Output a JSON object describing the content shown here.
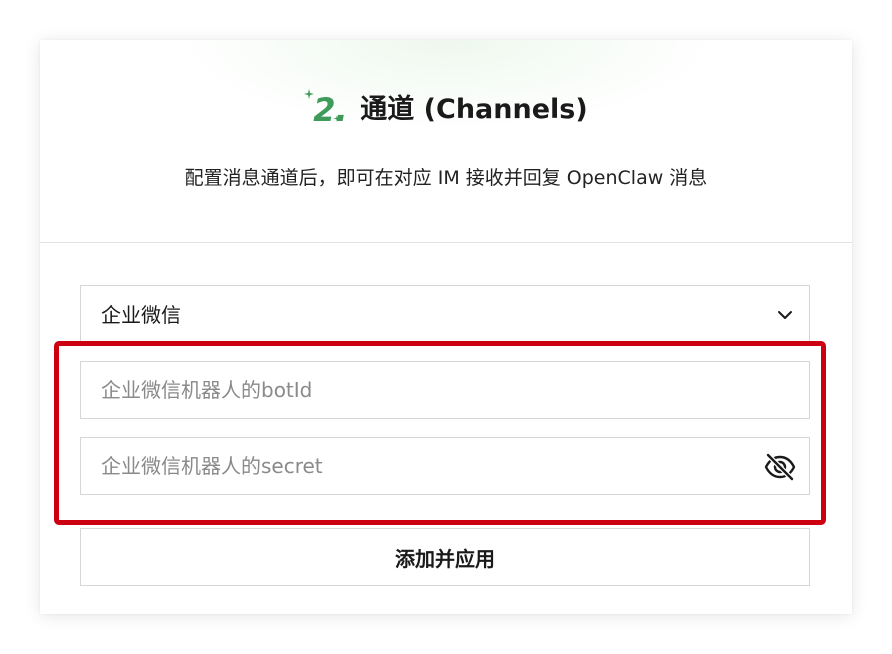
{
  "header": {
    "step_number": "2.",
    "title": "通道 (Channels)",
    "subtitle": "配置消息通道后，即可在对应 IM 接收并回复 OpenClaw 消息"
  },
  "form": {
    "channel_select": {
      "value": "企业微信"
    },
    "bot_id_input": {
      "value": "",
      "placeholder": "企业微信机器人的botId"
    },
    "secret_input": {
      "value": "",
      "placeholder": "企业微信机器人的secret"
    },
    "apply_button_label": "添加并应用"
  },
  "icons": {
    "step": "sparkle-step-icon",
    "select": "chevron-down-icon",
    "visibility": "eye-off-icon"
  },
  "colors": {
    "accent_green": "#3e9b5a",
    "highlight_red": "#cc0011"
  }
}
